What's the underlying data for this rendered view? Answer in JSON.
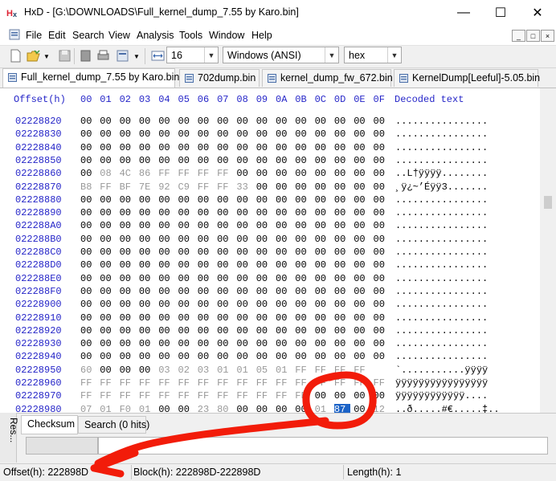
{
  "window": {
    "title": "HxD - [G:\\DOWNLOADS\\Full_kernel_dump_7.55 by Karo.bin]",
    "minimize_glyph": "—",
    "maximize_glyph": "☐",
    "close_glyph": "✕"
  },
  "menu": [
    "File",
    "Edit",
    "Search",
    "View",
    "Analysis",
    "Tools",
    "Window",
    "Help"
  ],
  "mdi_glyphs": [
    "_",
    "□",
    "×"
  ],
  "toolbar": {
    "bytes_per_row": "16",
    "charset": "Windows (ANSI)",
    "offset_base": "hex"
  },
  "tabs": [
    "Full_kernel_dump_7.55 by Karo.bin",
    "702dump.bin",
    "kernel_dump_fw_672.bin",
    "KernelDump[Leeful]-5.05.bin"
  ],
  "hex_view": {
    "offset_header": "Offset(h)",
    "column_headers": [
      "00",
      "01",
      "02",
      "03",
      "04",
      "05",
      "06",
      "07",
      "08",
      "09",
      "0A",
      "0B",
      "0C",
      "0D",
      "0E",
      "0F"
    ],
    "decoded_header": "Decoded text",
    "rows": [
      {
        "offset": "02228820",
        "bytes": [
          "00",
          "00",
          "00",
          "00",
          "00",
          "00",
          "00",
          "00",
          "00",
          "00",
          "00",
          "00",
          "00",
          "00",
          "00",
          "00"
        ],
        "decoded": "................"
      },
      {
        "offset": "02228830",
        "bytes": [
          "00",
          "00",
          "00",
          "00",
          "00",
          "00",
          "00",
          "00",
          "00",
          "00",
          "00",
          "00",
          "00",
          "00",
          "00",
          "00"
        ],
        "decoded": "................"
      },
      {
        "offset": "02228840",
        "bytes": [
          "00",
          "00",
          "00",
          "00",
          "00",
          "00",
          "00",
          "00",
          "00",
          "00",
          "00",
          "00",
          "00",
          "00",
          "00",
          "00"
        ],
        "decoded": "................"
      },
      {
        "offset": "02228850",
        "bytes": [
          "00",
          "00",
          "00",
          "00",
          "00",
          "00",
          "00",
          "00",
          "00",
          "00",
          "00",
          "00",
          "00",
          "00",
          "00",
          "00"
        ],
        "decoded": "................"
      },
      {
        "offset": "02228860",
        "bytes": [
          "00",
          "08",
          "4C",
          "86",
          "FF",
          "FF",
          "FF",
          "FF",
          "00",
          "00",
          "00",
          "00",
          "00",
          "00",
          "00",
          "00"
        ],
        "decoded": "..L†ÿÿÿÿ........"
      },
      {
        "offset": "02228870",
        "bytes": [
          "B8",
          "FF",
          "BF",
          "7E",
          "92",
          "C9",
          "FF",
          "FF",
          "33",
          "00",
          "00",
          "00",
          "00",
          "00",
          "00",
          "00"
        ],
        "decoded": "¸ÿ¿~’Éÿÿ3......."
      },
      {
        "offset": "02228880",
        "bytes": [
          "00",
          "00",
          "00",
          "00",
          "00",
          "00",
          "00",
          "00",
          "00",
          "00",
          "00",
          "00",
          "00",
          "00",
          "00",
          "00"
        ],
        "decoded": "................"
      },
      {
        "offset": "02228890",
        "bytes": [
          "00",
          "00",
          "00",
          "00",
          "00",
          "00",
          "00",
          "00",
          "00",
          "00",
          "00",
          "00",
          "00",
          "00",
          "00",
          "00"
        ],
        "decoded": "................"
      },
      {
        "offset": "022288A0",
        "bytes": [
          "00",
          "00",
          "00",
          "00",
          "00",
          "00",
          "00",
          "00",
          "00",
          "00",
          "00",
          "00",
          "00",
          "00",
          "00",
          "00"
        ],
        "decoded": "................"
      },
      {
        "offset": "022288B0",
        "bytes": [
          "00",
          "00",
          "00",
          "00",
          "00",
          "00",
          "00",
          "00",
          "00",
          "00",
          "00",
          "00",
          "00",
          "00",
          "00",
          "00"
        ],
        "decoded": "................"
      },
      {
        "offset": "022288C0",
        "bytes": [
          "00",
          "00",
          "00",
          "00",
          "00",
          "00",
          "00",
          "00",
          "00",
          "00",
          "00",
          "00",
          "00",
          "00",
          "00",
          "00"
        ],
        "decoded": "................"
      },
      {
        "offset": "022288D0",
        "bytes": [
          "00",
          "00",
          "00",
          "00",
          "00",
          "00",
          "00",
          "00",
          "00",
          "00",
          "00",
          "00",
          "00",
          "00",
          "00",
          "00"
        ],
        "decoded": "................"
      },
      {
        "offset": "022288E0",
        "bytes": [
          "00",
          "00",
          "00",
          "00",
          "00",
          "00",
          "00",
          "00",
          "00",
          "00",
          "00",
          "00",
          "00",
          "00",
          "00",
          "00"
        ],
        "decoded": "................"
      },
      {
        "offset": "022288F0",
        "bytes": [
          "00",
          "00",
          "00",
          "00",
          "00",
          "00",
          "00",
          "00",
          "00",
          "00",
          "00",
          "00",
          "00",
          "00",
          "00",
          "00"
        ],
        "decoded": "................"
      },
      {
        "offset": "02228900",
        "bytes": [
          "00",
          "00",
          "00",
          "00",
          "00",
          "00",
          "00",
          "00",
          "00",
          "00",
          "00",
          "00",
          "00",
          "00",
          "00",
          "00"
        ],
        "decoded": "................"
      },
      {
        "offset": "02228910",
        "bytes": [
          "00",
          "00",
          "00",
          "00",
          "00",
          "00",
          "00",
          "00",
          "00",
          "00",
          "00",
          "00",
          "00",
          "00",
          "00",
          "00"
        ],
        "decoded": "................"
      },
      {
        "offset": "02228920",
        "bytes": [
          "00",
          "00",
          "00",
          "00",
          "00",
          "00",
          "00",
          "00",
          "00",
          "00",
          "00",
          "00",
          "00",
          "00",
          "00",
          "00"
        ],
        "decoded": "................"
      },
      {
        "offset": "02228930",
        "bytes": [
          "00",
          "00",
          "00",
          "00",
          "00",
          "00",
          "00",
          "00",
          "00",
          "00",
          "00",
          "00",
          "00",
          "00",
          "00",
          "00"
        ],
        "decoded": "................"
      },
      {
        "offset": "02228940",
        "bytes": [
          "00",
          "00",
          "00",
          "00",
          "00",
          "00",
          "00",
          "00",
          "00",
          "00",
          "00",
          "00",
          "00",
          "00",
          "00",
          "00"
        ],
        "decoded": "................"
      },
      {
        "offset": "02228950",
        "bytes": [
          "60",
          "00",
          "00",
          "00",
          "03",
          "02",
          "03",
          "01",
          "01",
          "05",
          "01",
          "FF",
          "FF",
          "FF",
          "FF",
          ""
        ],
        "decoded": "`...........ÿÿÿÿ"
      },
      {
        "offset": "02228960",
        "bytes": [
          "FF",
          "FF",
          "FF",
          "FF",
          "FF",
          "FF",
          "FF",
          "FF",
          "FF",
          "FF",
          "FF",
          "FF",
          "FF",
          "FF",
          "FF",
          "FF"
        ],
        "decoded": "ÿÿÿÿÿÿÿÿÿÿÿÿÿÿÿÿ"
      },
      {
        "offset": "02228970",
        "bytes": [
          "FF",
          "FF",
          "FF",
          "FF",
          "FF",
          "FF",
          "FF",
          "FF",
          "FF",
          "FF",
          "FF",
          "FF",
          "00",
          "00",
          "00",
          "00"
        ],
        "decoded": "ÿÿÿÿÿÿÿÿÿÿÿÿ...."
      },
      {
        "offset": "02228980",
        "bytes": [
          "07",
          "01",
          "F0",
          "01",
          "00",
          "00",
          "23",
          "80",
          "00",
          "00",
          "00",
          "00",
          "01",
          "87",
          "00",
          "12"
        ],
        "decoded": "..ð.....#€.....‡.."
      }
    ],
    "selected": {
      "row": 22,
      "col": 13
    }
  },
  "bottom_panel": {
    "side_tab": "Res...",
    "tabs": [
      "Checksum",
      "Search (0 hits)"
    ]
  },
  "status": {
    "offset": "Offset(h): 222898D",
    "block": "Block(h): 222898D-222898D",
    "length": "Length(h): 1"
  },
  "colors": {
    "offset_blue": "#2525c8",
    "selection": "#1c63c7",
    "annotation_red": "#f21c0a"
  }
}
